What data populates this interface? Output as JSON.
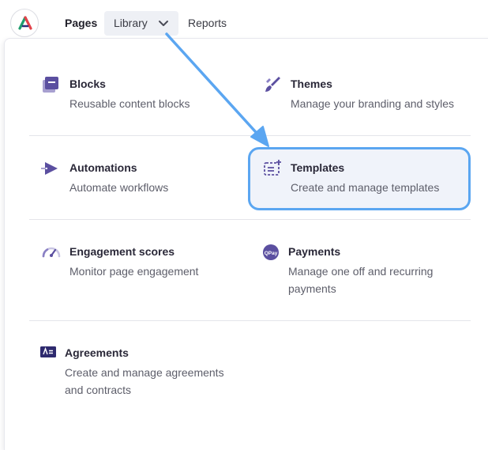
{
  "nav": {
    "pages": "Pages",
    "library": "Library",
    "reports": "Reports"
  },
  "items": {
    "blocks": {
      "title": "Blocks",
      "desc": "Reusable content blocks"
    },
    "themes": {
      "title": "Themes",
      "desc": "Manage your branding and styles"
    },
    "automations": {
      "title": "Automations",
      "desc": "Automate workflows"
    },
    "templates": {
      "title": "Templates",
      "desc": "Create and manage templates"
    },
    "engagement": {
      "title": "Engagement scores",
      "desc": "Monitor page engagement"
    },
    "payments": {
      "title": "Payments",
      "desc_line1": "Manage one off and recurring",
      "desc_line2": "payments",
      "icon_text": "QPay"
    },
    "agreements": {
      "title": "Agreements",
      "desc_line1": "Create and manage agreements",
      "desc_line2": "and contracts"
    }
  },
  "colors": {
    "icon_purple": "#5b4fa0",
    "highlight_border": "#5ba6f1",
    "arrow": "#5ba6f1"
  }
}
